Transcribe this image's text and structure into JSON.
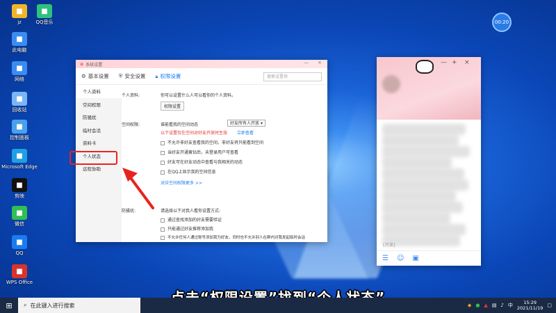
{
  "desktop": {
    "icons": [
      {
        "label": "jz",
        "icon": "folder-icon",
        "color": "#f0b429"
      },
      {
        "label": "QQ音乐",
        "icon": "qq-music-icon",
        "color": "#2ec27e"
      },
      {
        "label": "此电脑",
        "icon": "computer-icon",
        "color": "#3b8cf0"
      },
      {
        "label": "网络",
        "icon": "network-icon",
        "color": "#3b8cf0"
      },
      {
        "label": "回收站",
        "icon": "recycle-bin-icon",
        "color": "#7ab6f5"
      },
      {
        "label": "控制面板",
        "icon": "control-panel-icon",
        "color": "#4aa0f0"
      },
      {
        "label": "Microsoft Edge",
        "icon": "edge-icon",
        "color": "#1fa0e0"
      },
      {
        "label": "剪映",
        "icon": "capcut-icon",
        "color": "#111111"
      },
      {
        "label": "微信",
        "icon": "wechat-icon",
        "color": "#2fbf52"
      },
      {
        "label": "QQ",
        "icon": "qq-icon",
        "color": "#1a7cf0"
      },
      {
        "label": "WPS Office",
        "icon": "wps-icon",
        "color": "#d9342b"
      }
    ],
    "clock_badge": "00:20"
  },
  "settings": {
    "title": "系统设置",
    "tabs": [
      {
        "label": "基本设置",
        "icon": "gear-icon"
      },
      {
        "label": "安全设置",
        "icon": "shield-icon"
      },
      {
        "label": "权限设置",
        "icon": "lock-icon"
      }
    ],
    "active_tab": 2,
    "search_placeholder": "搜索设置项",
    "sidebar": [
      "个人资料",
      "空间权限",
      "防骚扰",
      "临时会话",
      "资料卡",
      "个人状态",
      "远程协助"
    ],
    "active_sidebar": 0,
    "personal": {
      "label": "个人资料:",
      "desc": "你可以设置什么人可以看你的个人资料。",
      "button": "权限设置"
    },
    "space": {
      "label": "空间权限:",
      "allow_label": "谁能看我的空间动态",
      "allow_value": "好友所有人开放",
      "warning": "以下设置仅在空间对好友开放时生效",
      "link": "立即查看",
      "options": [
        "不允许非好友查看我的空间，非好友将只能看到空间",
        "当好友开通黄钻后，未登录用户可查看",
        "好友可在好友动态中查看与我相关的动态",
        "在QQ上显示我的空间信息"
      ],
      "more_link": "对应空间权限更多 >>"
    },
    "harass": {
      "label": "防骚扰:",
      "desc": "请选择以下对我人看你设置方式:",
      "options": [
        "通过查找添加的好友需要验证",
        "只能通过好友推荐添加我",
        "不允许任何人通过账号添加我为好友，同时也不允许别人在群内对我发起临时会话"
      ]
    }
  },
  "chat": {
    "search_placeholder": "{只读}",
    "window_controls": [
      "—",
      "+",
      "×"
    ]
  },
  "subtitle": "点击“权限设置”找到“个人状态”",
  "taskbar": {
    "search_placeholder": "在此键入进行搜索",
    "time": "15:29",
    "date": "2021/11/19",
    "ime": "中"
  }
}
